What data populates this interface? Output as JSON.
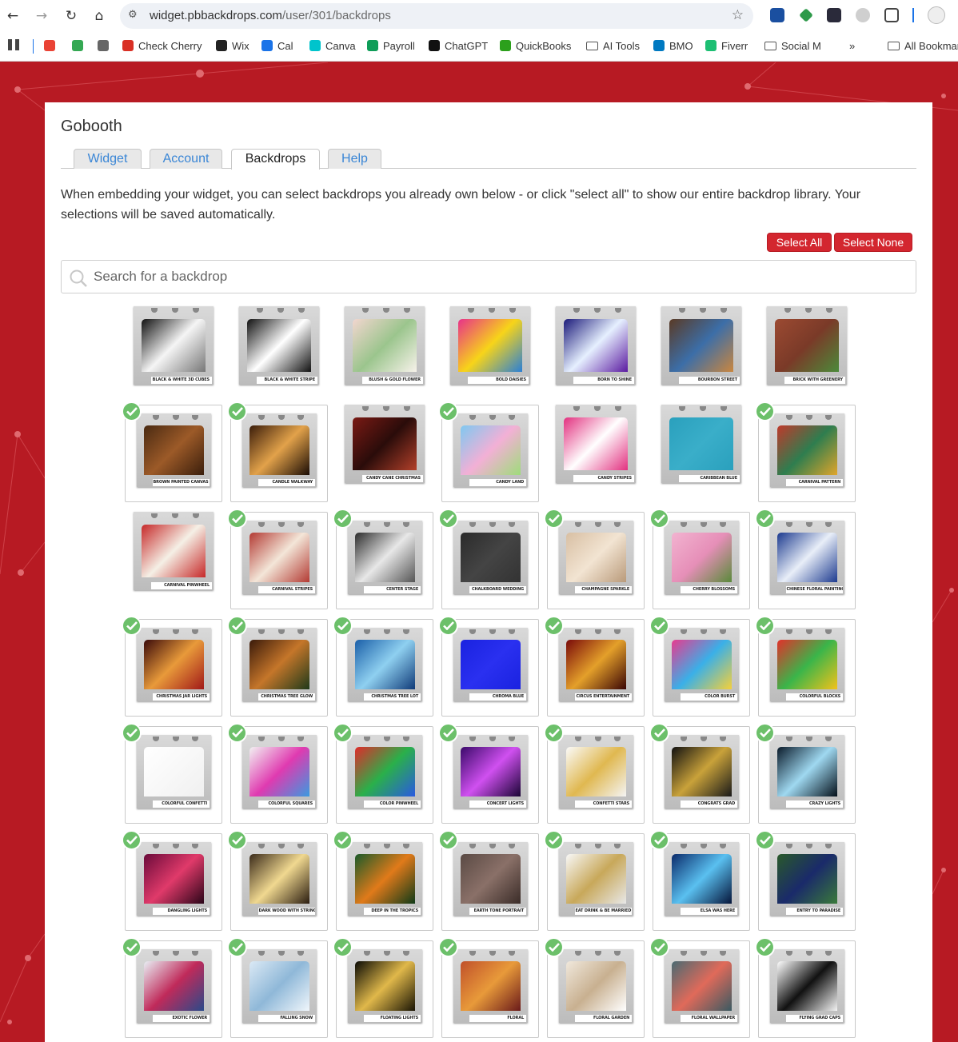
{
  "browser": {
    "url_host": "widget.pbbackdrops.com",
    "url_path": "/user/301/backdrops",
    "bookmarks": [
      {
        "label": "",
        "icon": "gmail-icon",
        "color": "#ea4335"
      },
      {
        "label": "",
        "icon": "drive-icon",
        "color": "#34a853"
      },
      {
        "label": "",
        "icon": "app-icon",
        "color": "#666666"
      },
      {
        "label": "Check Cherry",
        "icon": "check-cherry-icon",
        "color": "#d93025"
      },
      {
        "label": "Wix",
        "icon": "wix-icon",
        "color": "#222222"
      },
      {
        "label": "Cal",
        "icon": "calendar-icon",
        "color": "#1a73e8"
      },
      {
        "label": "Canva",
        "icon": "canva-icon",
        "color": "#00c4cc"
      },
      {
        "label": "Payroll",
        "icon": "payroll-icon",
        "color": "#0f9d58"
      },
      {
        "label": "ChatGPT",
        "icon": "chatgpt-icon",
        "color": "#111111"
      },
      {
        "label": "QuickBooks",
        "icon": "quickbooks-icon",
        "color": "#2ca01c"
      },
      {
        "label": "AI Tools",
        "icon": "folder-icon",
        "color": ""
      },
      {
        "label": "BMO",
        "icon": "bmo-icon",
        "color": "#0079c1"
      },
      {
        "label": "Fiverr",
        "icon": "fiverr-icon",
        "color": "#1dbf73"
      },
      {
        "label": "Social M",
        "icon": "folder-icon",
        "color": ""
      },
      {
        "label": "»",
        "icon": "more-icon",
        "color": ""
      },
      {
        "label": "All Bookmarks",
        "icon": "folder-icon",
        "color": ""
      }
    ]
  },
  "app": {
    "title": "Gobooth",
    "tabs": [
      "Widget",
      "Account",
      "Backdrops",
      "Help"
    ],
    "active_tab": "Backdrops",
    "intro": "When embedding your widget, you can select backdrops you already own below - or click \"select all\" to show our entire backdrop library. Your selections will be saved automatically.",
    "select_all_label": "Select All",
    "select_none_label": "Select None",
    "search_placeholder": "Search for a backdrop",
    "accent_color": "#d3262f",
    "selected_check_color": "#6cc06a"
  },
  "backdrops": [
    {
      "name": "BLACK & WHITE 3D CUBES",
      "selected": false,
      "colors": [
        "#111111",
        "#f5f5f5",
        "#777777"
      ]
    },
    {
      "name": "BLACK & WHITE STRIPE",
      "selected": false,
      "colors": [
        "#111111",
        "#ffffff",
        "#111111"
      ]
    },
    {
      "name": "BLUSH & GOLD FLOWER",
      "selected": false,
      "colors": [
        "#f2d6cf",
        "#9bc58d",
        "#f7f2ea"
      ]
    },
    {
      "name": "BOLD DAISIES",
      "selected": false,
      "colors": [
        "#e8318a",
        "#f7d419",
        "#2a7fd6"
      ]
    },
    {
      "name": "BORN TO SHINE",
      "selected": false,
      "colors": [
        "#1b1a7a",
        "#e6f0ff",
        "#5a1aa0"
      ]
    },
    {
      "name": "BOURBON STREET",
      "selected": false,
      "colors": [
        "#5a3a25",
        "#3c6ea8",
        "#c9863f"
      ]
    },
    {
      "name": "BRICK WITH GREENERY",
      "selected": false,
      "colors": [
        "#9c4a32",
        "#7a3a28",
        "#4c8a3a"
      ]
    },
    {
      "name": "BROWN PAINTED CANVAS",
      "selected": true,
      "colors": [
        "#4a2a12",
        "#9c5a28",
        "#3a1e0c"
      ]
    },
    {
      "name": "CANDLE WALKWAY",
      "selected": true,
      "colors": [
        "#3a1c0a",
        "#e2a24a",
        "#1a0c05"
      ]
    },
    {
      "name": "CANDY CANE CHRISTMAS",
      "selected": false,
      "colors": [
        "#7a1a14",
        "#2a0c0a",
        "#b3402a"
      ]
    },
    {
      "name": "CANDY LAND",
      "selected": true,
      "colors": [
        "#7fc8f0",
        "#f3b0d6",
        "#9edc7a"
      ]
    },
    {
      "name": "CANDY STRIPES",
      "selected": false,
      "colors": [
        "#e2307f",
        "#ffffff",
        "#e2307f"
      ]
    },
    {
      "name": "CARIBBEAN BLUE",
      "selected": false,
      "colors": [
        "#2aa0bd",
        "#3aaec9",
        "#2aa0bd"
      ]
    },
    {
      "name": "CARNIVAL PATTERN",
      "selected": true,
      "colors": [
        "#c0392b",
        "#2e7d4f",
        "#e0a52a"
      ]
    },
    {
      "name": "CARNIVAL PINWHEEL",
      "selected": false,
      "colors": [
        "#c62828",
        "#f5f0e6",
        "#c62828"
      ]
    },
    {
      "name": "CARNIVAL STRIPES",
      "selected": true,
      "colors": [
        "#b33a33",
        "#f3e6d8",
        "#b33a33"
      ]
    },
    {
      "name": "CENTER STAGE",
      "selected": true,
      "colors": [
        "#2c2c2c",
        "#e8e8e8",
        "#555555"
      ]
    },
    {
      "name": "CHALKBOARD WEDDING",
      "selected": true,
      "colors": [
        "#2b2b2b",
        "#444444",
        "#333333"
      ]
    },
    {
      "name": "CHAMPAGNE SPARKLE",
      "selected": true,
      "colors": [
        "#d8bfa3",
        "#f2e4d2",
        "#b99a7a"
      ]
    },
    {
      "name": "CHERRY BLOSSOMS",
      "selected": true,
      "colors": [
        "#f2b3d0",
        "#e68fb8",
        "#5a8a3a"
      ]
    },
    {
      "name": "CHINESE FLORAL PAINTING",
      "selected": true,
      "colors": [
        "#1c3a8f",
        "#e8eef8",
        "#1c3a8f"
      ]
    },
    {
      "name": "CHRISTMAS JAR LIGHTS",
      "selected": true,
      "colors": [
        "#3a0a0a",
        "#e89a3a",
        "#a01818"
      ]
    },
    {
      "name": "CHRISTMAS TREE GLOW",
      "selected": true,
      "colors": [
        "#3a1a0a",
        "#c5762a",
        "#1f3a1a"
      ]
    },
    {
      "name": "CHRISTMAS TREE LOT",
      "selected": true,
      "colors": [
        "#1a5fa8",
        "#8fd0f0",
        "#0f3a78"
      ]
    },
    {
      "name": "CHROMA BLUE",
      "selected": true,
      "colors": [
        "#1a22e0",
        "#2a30f0",
        "#1a22e0"
      ]
    },
    {
      "name": "CIRCUS ENTERTAINMENT",
      "selected": true,
      "colors": [
        "#7a0a0a",
        "#e4a02a",
        "#3a0505"
      ]
    },
    {
      "name": "COLOR BURST",
      "selected": true,
      "colors": [
        "#e83a8f",
        "#3ab0e8",
        "#f5d03a"
      ]
    },
    {
      "name": "COLORFUL BLOCKS",
      "selected": true,
      "colors": [
        "#e2302a",
        "#3ab54a",
        "#f2c21a"
      ]
    },
    {
      "name": "COLORFUL CONFETTI",
      "selected": true,
      "colors": [
        "#ffffff",
        "#f8f8f8",
        "#f0f0f0"
      ]
    },
    {
      "name": "COLORFUL SQUARES",
      "selected": true,
      "colors": [
        "#f2f2f2",
        "#e03ab0",
        "#3a9ae0"
      ]
    },
    {
      "name": "COLOR PINWHEEL",
      "selected": true,
      "colors": [
        "#e02a2a",
        "#2ab04a",
        "#2a5ae0"
      ]
    },
    {
      "name": "CONCERT LIGHTS",
      "selected": true,
      "colors": [
        "#3a0a6a",
        "#d050f0",
        "#1a0535"
      ]
    },
    {
      "name": "CONFETTI STARS",
      "selected": true,
      "colors": [
        "#fafafa",
        "#e0b850",
        "#f4f4f4"
      ]
    },
    {
      "name": "CONGRATS GRAD",
      "selected": true,
      "colors": [
        "#111111",
        "#c9a23a",
        "#1a1a1a"
      ]
    },
    {
      "name": "CRAZY LIGHTS",
      "selected": true,
      "colors": [
        "#0a1a2a",
        "#9fd8f0",
        "#05101a"
      ]
    },
    {
      "name": "DANGLING LIGHTS",
      "selected": true,
      "colors": [
        "#6a0a3a",
        "#e03a6a",
        "#2a0518"
      ]
    },
    {
      "name": "DARK WOOD WITH STRING LIGHTS",
      "selected": true,
      "colors": [
        "#3a2a1a",
        "#f0d890",
        "#2a1c10"
      ]
    },
    {
      "name": "DEEP IN THE TROPICS",
      "selected": true,
      "colors": [
        "#1a5a2a",
        "#e07a1a",
        "#0f3a18"
      ]
    },
    {
      "name": "EARTH TONE PORTRAIT",
      "selected": true,
      "colors": [
        "#5a4a44",
        "#8a7068",
        "#3a2c28"
      ]
    },
    {
      "name": "EAT DRINK & BE MARRIED",
      "selected": true,
      "colors": [
        "#f8f8f8",
        "#c8a85a",
        "#e8e8e8"
      ]
    },
    {
      "name": "ELSA WAS HERE",
      "selected": true,
      "colors": [
        "#0a2a6a",
        "#5ac0f0",
        "#05153a"
      ]
    },
    {
      "name": "ENTRY TO PARADISE",
      "selected": true,
      "colors": [
        "#2a5a2a",
        "#1a2a6a",
        "#3a7a3a"
      ]
    },
    {
      "name": "EXOTIC FLOWER",
      "selected": true,
      "colors": [
        "#e8eef4",
        "#c02a5a",
        "#2a4a8a"
      ]
    },
    {
      "name": "FALLING SNOW",
      "selected": true,
      "colors": [
        "#dbe9f5",
        "#8fb8d8",
        "#f0f6fb"
      ]
    },
    {
      "name": "FLOATING LIGHTS",
      "selected": true,
      "colors": [
        "#0a0a05",
        "#e0b84a",
        "#1a1505"
      ]
    },
    {
      "name": "FLORAL",
      "selected": true,
      "colors": [
        "#c0502a",
        "#e89a3a",
        "#6a1a1a"
      ]
    },
    {
      "name": "FLORAL GARDEN",
      "selected": true,
      "colors": [
        "#f0e8dc",
        "#c8b090",
        "#ffffff"
      ]
    },
    {
      "name": "FLORAL WALLPAPER",
      "selected": true,
      "colors": [
        "#4a6a72",
        "#e06a5a",
        "#3a5a62"
      ]
    },
    {
      "name": "FLYING GRAD CAPS",
      "selected": true,
      "colors": [
        "#ffffff",
        "#111111",
        "#f4f4f4"
      ]
    }
  ]
}
